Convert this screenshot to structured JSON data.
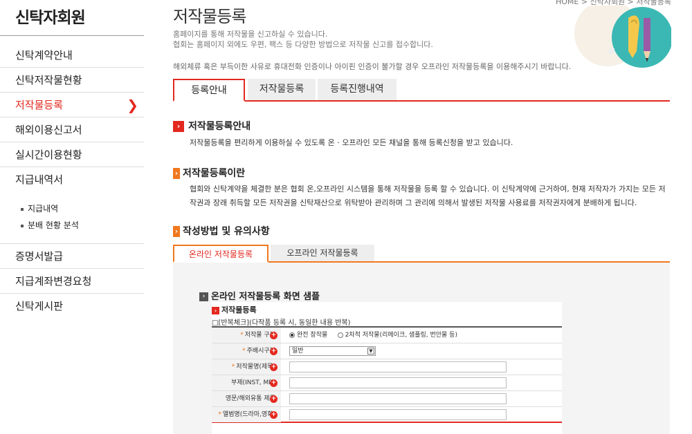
{
  "sidebar": {
    "title": "신탁자회원",
    "items": [
      {
        "label": "신탁계약안내"
      },
      {
        "label": "신탁저작물현황"
      },
      {
        "label": "저작물등록",
        "active": true
      },
      {
        "label": "해외이용신고서"
      },
      {
        "label": "실시간이용현황"
      },
      {
        "label": "지급내역서"
      }
    ],
    "sub_items": [
      "지급내역",
      "분배 현황 분석"
    ],
    "items_after": [
      {
        "label": "증명서발급"
      },
      {
        "label": "지급계좌변경요청"
      },
      {
        "label": "신탁게시판"
      }
    ]
  },
  "header": {
    "breadcrumb": "HOME > 신탁자회원 > 저작물등록",
    "title": "저작물등록",
    "intro_line1": "홈페이지를 통해 저작물을 신고하실 수 있습니다.",
    "intro_line2": "협회는 홈페이지 외에도 우편, 팩스 등 다양한 방법으로 저작물 신고를 접수합니다.",
    "notice": "해외체류 혹은 부득이한 사유로 휴대전화 인증이나 아이핀 인증이 불가할 경우 오프라인 저작물등록을 이용해주시기 바랍니다."
  },
  "tabs": [
    "등록안내",
    "저작물등록",
    "등록진행내역"
  ],
  "sections": {
    "guide_title": "저작물등록안내",
    "guide_text": "저작물등록을 편리하게 이용하실 수 있도록 온 · 오프라인 모든 채널을 통해 등록신청을 받고 있습니다.",
    "what_title": "저작물등록이란",
    "what_text1": "협회와 신탁계약을 체결한 분은 협회 온,오프라인 시스템을 통해 저작물을 등록 할 수 있습니다. 이 신탁계약에 근거하여, 현재 저작자가 가지는 모든 저",
    "what_text2": "작권과 장래 취득할 모든 저작권을 신탁재산으로 위탁받아 관리하며 그 관리에 의해서 발생된 저작물 사용료를 저작권자에게 분배하게 됩니다.",
    "method_title": "작성방법 및 유의사항"
  },
  "subtabs": [
    "온라인 저작물등록",
    "오프라인 저작물등록"
  ],
  "sample": {
    "title": "온라인 저작물등록 화면 샘플",
    "form_title": "저작물등록",
    "repeat_label": "□[반복체크](다작품 등록 시, 동일한 내용 반복)",
    "rows": [
      {
        "label": "저작물 구분",
        "required": true,
        "type": "radio",
        "options": [
          "완전 창작물",
          "2차적 저작물(리메이크, 샘플링, 번안물 등)"
        ]
      },
      {
        "label": "주배시구분",
        "required": true,
        "type": "select",
        "value": "일반"
      },
      {
        "label": "저작물명(제목)",
        "required": true,
        "type": "input"
      },
      {
        "label": "부제(INST, MR)",
        "required": false,
        "type": "input"
      },
      {
        "label": "영문/해외유통 제목",
        "required": false,
        "type": "input"
      },
      {
        "label": "앨범명(드라마,영화)",
        "required": true,
        "type": "input"
      }
    ]
  },
  "colors": {
    "accent": "#e3281f",
    "orange": "#f0781e"
  }
}
